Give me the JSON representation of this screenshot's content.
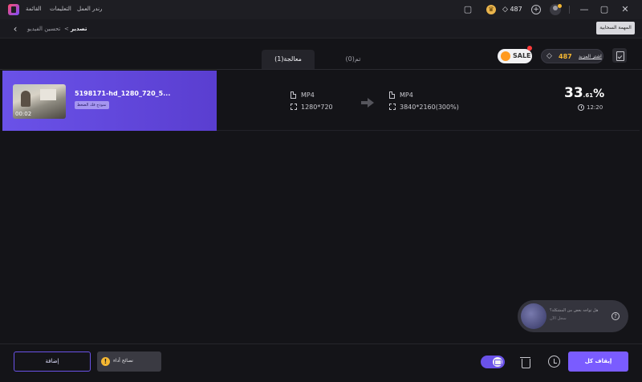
{
  "titlebar": {
    "menu": [
      "القائمة",
      "التعليمات",
      "رندر العمل"
    ],
    "gem_count": "487",
    "icons": {
      "logo": "app-logo-icon",
      "screen": "screen-record-icon",
      "coin": "coin-icon",
      "gem": "diamond-icon",
      "plus": "plus-icon",
      "avatar": "user-avatar-icon",
      "minimize": "minimize-icon",
      "maximize": "maximize-icon",
      "close": "close-icon"
    }
  },
  "breadcrumb": {
    "parent": "تحسين الفيديو",
    "separator": "<",
    "current": "تصدير"
  },
  "cloud_task_label": "المهمة السحابية",
  "tabs": {
    "active": "معالجة(1)",
    "inactive": "تم(0)"
  },
  "promo": {
    "sale_label": "SALE",
    "gems": "487",
    "more_label": "اشتر المزيد"
  },
  "file": {
    "name": "5198171-hd_1280_720_5...",
    "duration": "00:02",
    "model_tag": "نموذج فك الضغط",
    "input": {
      "format": "MP4",
      "resolution": "1280*720"
    },
    "output": {
      "format": "MP4",
      "resolution": "3840*2160(300%)"
    },
    "progress": {
      "whole": "33",
      "fraction": ".61",
      "unit": "%"
    },
    "eta": "12:20"
  },
  "feedback": {
    "question": "هل تواجه بعض من المشكلة؟",
    "answer": "سجل الآن"
  },
  "bottom": {
    "add_label": "إضافة",
    "tips_label": "نصائح أداء",
    "stop_all_label": "إيقاف كل"
  },
  "colors": {
    "accent": "#6a52e8",
    "accent_button": "#7a5cff",
    "gem_gold": "#f5b732",
    "background": "#141418"
  }
}
